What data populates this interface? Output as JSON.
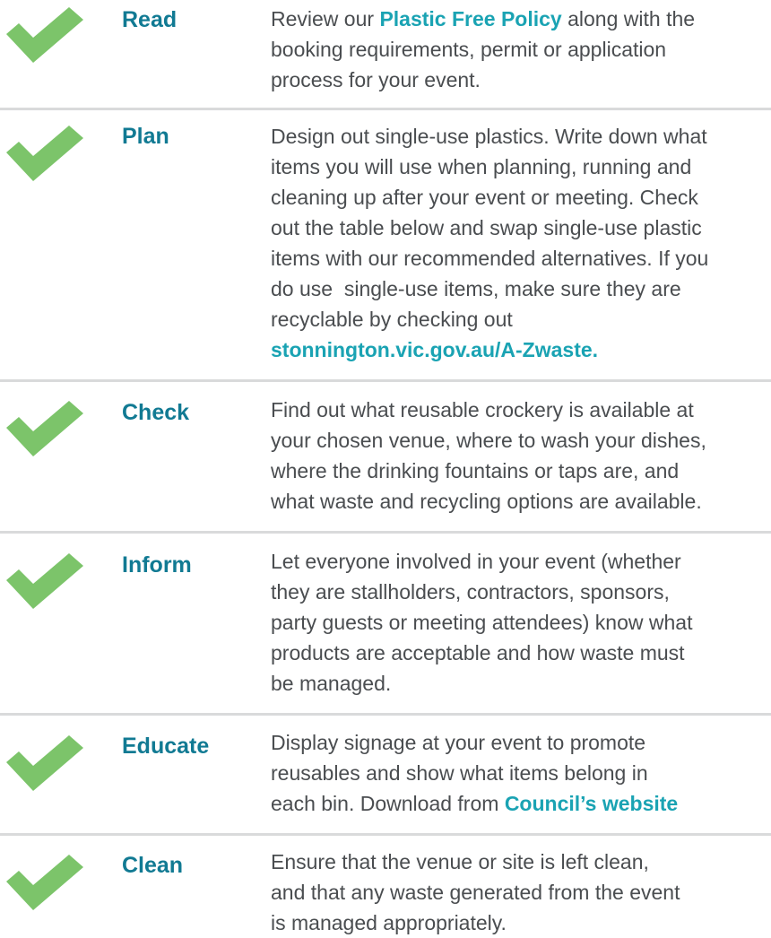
{
  "colors": {
    "check": "#7cc46a",
    "heading": "#117a93",
    "link": "#1aa3b3",
    "body_text": "#4a4d50",
    "divider": "#d9dadb"
  },
  "steps": [
    {
      "icon": "checkmark-icon",
      "heading": "Read",
      "lines": [
        {
          "before": "Review our ",
          "link": "Plastic Free Policy",
          "after": " along with the"
        },
        {
          "text": "booking requirements, permit or application"
        },
        {
          "text": "process for your event."
        }
      ]
    },
    {
      "icon": "checkmark-icon",
      "heading": "Plan",
      "lines": [
        {
          "text": "Design out single-use plastics. Write down what"
        },
        {
          "text": "items you will use when planning, running and"
        },
        {
          "text": "cleaning up after your event or meeting. Check"
        },
        {
          "text": "out the table below and swap single-use plastic"
        },
        {
          "text": "items with our recommended alternatives. If you"
        },
        {
          "text": "do use  single-use items, make sure they are"
        },
        {
          "text": "recyclable by checking out"
        },
        {
          "before": "",
          "link": "stonnington.vic.gov.au/A-Zwaste.",
          "after": ""
        }
      ]
    },
    {
      "icon": "checkmark-icon",
      "heading": "Check",
      "lines": [
        {
          "text": "Find out what reusable crockery is available at"
        },
        {
          "text": "your chosen venue, where to wash your dishes,"
        },
        {
          "text": "where the drinking fountains or taps are, and"
        },
        {
          "text": "what waste and recycling options are available."
        }
      ]
    },
    {
      "icon": "checkmark-icon",
      "heading": "Inform",
      "lines": [
        {
          "text": "Let everyone involved in your event (whether"
        },
        {
          "text": "they are stallholders, contractors, sponsors,"
        },
        {
          "text": "party guests or meeting attendees) know what"
        },
        {
          "text": "products are acceptable and how waste must"
        },
        {
          "text": "be managed."
        }
      ]
    },
    {
      "icon": "checkmark-icon",
      "heading": "Educate",
      "lines": [
        {
          "text": "Display signage at your event to promote"
        },
        {
          "text": "reusables and show what items belong in"
        },
        {
          "before": "each bin. Download from ",
          "link": "Council’s website",
          "after": ""
        }
      ]
    },
    {
      "icon": "checkmark-icon",
      "heading": "Clean",
      "lines": [
        {
          "text": "Ensure that the venue or site is left clean,"
        },
        {
          "text": "and that any waste generated from the event"
        },
        {
          "text": "is managed appropriately."
        }
      ]
    }
  ]
}
